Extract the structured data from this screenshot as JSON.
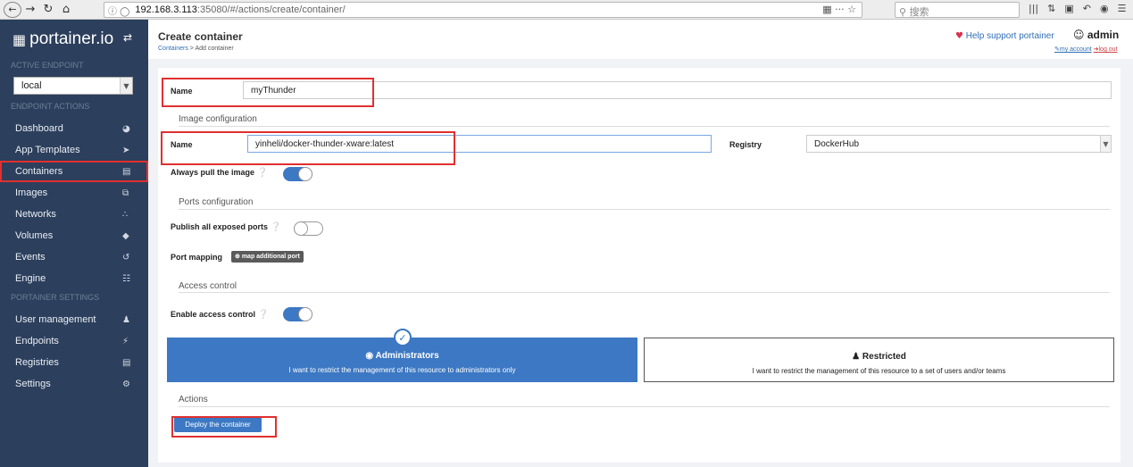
{
  "browser": {
    "url_host": "192.168.3.113",
    "url_path": ":35080/#/actions/create/container/",
    "search_placeholder": "搜索"
  },
  "sidebar": {
    "brand": "portainer.io",
    "active_endpoint_heading": "ACTIVE ENDPOINT",
    "endpoint_value": "local",
    "endpoint_actions_heading": "ENDPOINT ACTIONS",
    "items": [
      {
        "label": "Dashboard",
        "icon": "dashboard-icon"
      },
      {
        "label": "App Templates",
        "icon": "rocket-icon"
      },
      {
        "label": "Containers",
        "icon": "server-icon"
      },
      {
        "label": "Images",
        "icon": "clone-icon"
      },
      {
        "label": "Networks",
        "icon": "sitemap-icon"
      },
      {
        "label": "Volumes",
        "icon": "cubes-icon"
      },
      {
        "label": "Events",
        "icon": "history-icon"
      },
      {
        "label": "Engine",
        "icon": "th-icon"
      }
    ],
    "settings_heading": "PORTAINER SETTINGS",
    "settings_items": [
      {
        "label": "User management",
        "icon": "users-icon"
      },
      {
        "label": "Endpoints",
        "icon": "plug-icon"
      },
      {
        "label": "Registries",
        "icon": "database-icon"
      },
      {
        "label": "Settings",
        "icon": "cogs-icon"
      }
    ]
  },
  "header": {
    "title": "Create container",
    "crumb_link": "Containers",
    "crumb_sep": " > ",
    "crumb_current": "Add container",
    "help_link": "Help support portainer",
    "username": "admin",
    "my_account": "my account",
    "logout": "log out"
  },
  "form": {
    "name_label": "Name",
    "name_value": "myThunder",
    "image_section": "Image configuration",
    "image_name_label": "Name",
    "image_value": "yinheli/docker-thunder-xware:latest",
    "registry_label": "Registry",
    "registry_value": "DockerHub",
    "always_pull_label": "Always pull the image",
    "always_pull": true,
    "ports_section": "Ports configuration",
    "publish_all_label": "Publish all exposed ports",
    "publish_all": false,
    "port_mapping_label": "Port mapping",
    "map_port_button": "map additional port",
    "access_section": "Access control",
    "enable_access_label": "Enable access control",
    "enable_access": true,
    "admin_card_title": "Administrators",
    "admin_card_desc": "I want to restrict the management of this resource to administrators only",
    "restricted_card_title": "Restricted",
    "restricted_card_desc": "I want to restrict the management of this resource to a set of users and/or teams",
    "actions_section": "Actions",
    "deploy_button": "Deploy the container"
  },
  "colors": {
    "sidebar_bg": "#2c3f5c",
    "primary": "#3c78c3",
    "highlight_box": "#e03030"
  }
}
